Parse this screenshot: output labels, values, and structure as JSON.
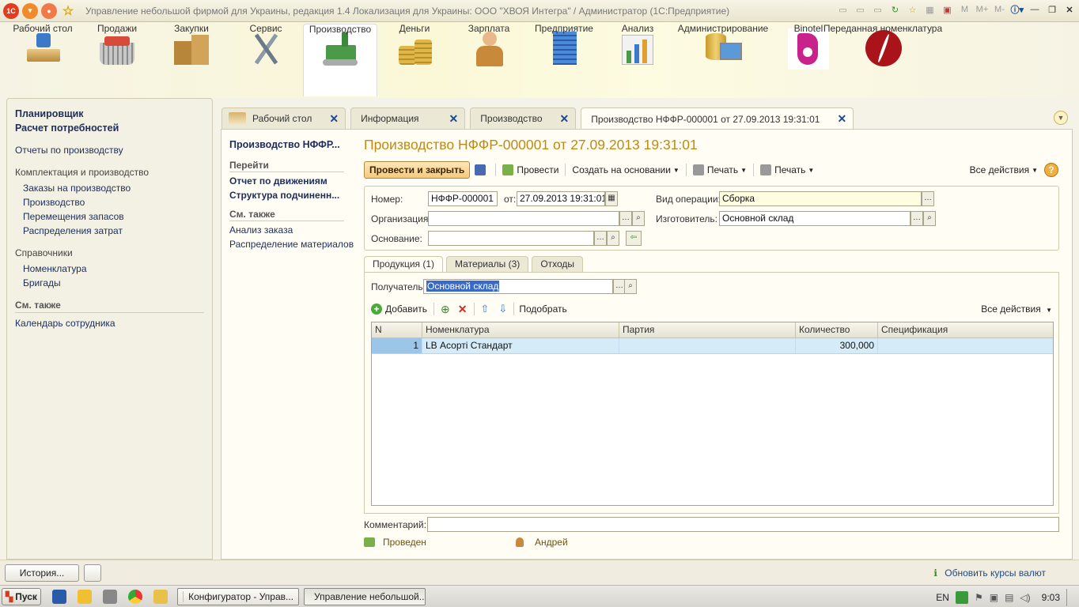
{
  "window": {
    "title": "Управление небольшой фирмой для Украины, редакция 1.4 Локализация для Украины: ООО \"ХВОЯ Интегра\" / Администратор  (1С:Предприятие)",
    "calc_buttons": [
      "M",
      "M+",
      "M-"
    ]
  },
  "sections": [
    {
      "label": "Рабочий стол",
      "icon": "desk-icon"
    },
    {
      "label": "Продажи",
      "icon": "basket-icon"
    },
    {
      "label": "Закупки",
      "icon": "boxes-icon"
    },
    {
      "label": "Сервис",
      "icon": "tools-icon"
    },
    {
      "label": "Производство",
      "icon": "factory-icon"
    },
    {
      "label": "Деньги",
      "icon": "coins-icon"
    },
    {
      "label": "Зарплата",
      "icon": "worker-icon"
    },
    {
      "label": "Предприятие",
      "icon": "building-icon"
    },
    {
      "label": "Анализ",
      "icon": "chart-icon"
    },
    {
      "label": "Администрирование",
      "icon": "database-icon"
    },
    {
      "label": "Binotel",
      "icon": "binotel-logo-icon"
    },
    {
      "label": "Переданная номенклатура",
      "icon": "coffee-bean-icon"
    }
  ],
  "leftnav": {
    "top_links": [
      "Планировщик",
      "Расчет потребностей"
    ],
    "reports": "Отчеты по производству",
    "group1": {
      "title": "Комплектация и производство",
      "items": [
        "Заказы на производство",
        "Производство",
        "Перемещения запасов",
        "Распределения затрат"
      ]
    },
    "group2": {
      "title": "Справочники",
      "items": [
        "Номенклатура",
        "Бригады"
      ]
    },
    "see_also": {
      "title": "См. также",
      "items": [
        "Календарь сотрудника"
      ]
    }
  },
  "tabs": [
    {
      "label": "Рабочий стол"
    },
    {
      "label": "Информация"
    },
    {
      "label": "Производство"
    },
    {
      "label": "Производство НФФР-000001 от 27.09.2013 19:31:01"
    }
  ],
  "formnav": {
    "title": "Производство НФФР...",
    "goto_header": "Перейти",
    "goto_items": [
      "Отчет по движениям",
      "Структура подчиненн..."
    ],
    "see_also_header": "См. также",
    "see_also_items": [
      "Анализ заказа",
      "Распределение материалов"
    ]
  },
  "form": {
    "title": "Производство НФФР-000001 от 27.09.2013 19:31:01",
    "toolbar": {
      "post_close": "Провести и закрыть",
      "post": "Провести",
      "create_based": "Создать на основании",
      "print1": "Печать",
      "print2": "Печать",
      "all_actions": "Все действия",
      "help": "?"
    },
    "header": {
      "number_label": "Номер:",
      "number_value": "НФФР-000001",
      "from_label": "от:",
      "date_value": "27.09.2013 19:31:01",
      "operation_label": "Вид операции:",
      "operation_value": "Сборка",
      "org_label": "Организация:",
      "org_value": "",
      "maker_label": "Изготовитель:",
      "maker_value": "Основной склад",
      "basis_label": "Основание:",
      "basis_value": ""
    },
    "inner_tabs": [
      "Продукция (1)",
      "Материалы (3)",
      "Отходы"
    ],
    "recipient_label": "Получатель:",
    "recipient_value": "Основной склад",
    "grid_toolbar": {
      "add": "Добавить",
      "pick": "Подобрать",
      "all_actions": "Все действия"
    },
    "grid": {
      "columns": [
        "N",
        "Номенклатура",
        "Партия",
        "Количество",
        "Спецификация"
      ],
      "rows": [
        {
          "n": "1",
          "item": "LB Асорті Стандарт",
          "batch": "",
          "qty": "300,000",
          "spec": ""
        }
      ]
    },
    "comment_label": "Комментарий:",
    "comment_value": "",
    "status": "Проведен",
    "author": "Андрей"
  },
  "statusbar": {
    "history": "История...",
    "rates": "Обновить курсы валют"
  },
  "taskbar": {
    "start": "Пуск",
    "tasks": [
      "Конфигуратор - Управ...",
      "Управление небольшой..."
    ],
    "lang": "EN",
    "time": "9:03"
  }
}
